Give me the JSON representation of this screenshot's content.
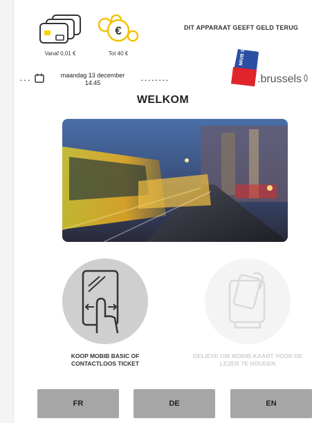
{
  "header": {
    "card_caption": "Vanaf 0,01 €",
    "coin_caption": "Tot 40 €",
    "coin_symbol": "€",
    "change_notice": "DIT APPARAAT GEEFT GELD TERUG"
  },
  "datetime": {
    "date": "maandag 13 december",
    "time": "14:45"
  },
  "logo": {
    "stib_text": "MIVB STIB",
    "brussels_text": ".brussels"
  },
  "title": "WELKOM",
  "options": [
    {
      "label": "KOOP MOBIB BASIC OF CONTACTLOOS TICKET",
      "enabled": true
    },
    {
      "label": "GELIEVE UW MOBIB-KAART VOOR DE LEZER TE HOUDEN",
      "enabled": false
    }
  ],
  "languages": [
    "FR",
    "DE",
    "EN"
  ],
  "colors": {
    "coin_yellow": "#f2c200",
    "card_chip": "#f5d400",
    "stib_red": "#e0242c",
    "stib_blue": "#2b4fa3",
    "button_gray": "#a6a6a6",
    "circle_active": "#cfcfcf",
    "circle_disabled": "#f4f4f4"
  }
}
